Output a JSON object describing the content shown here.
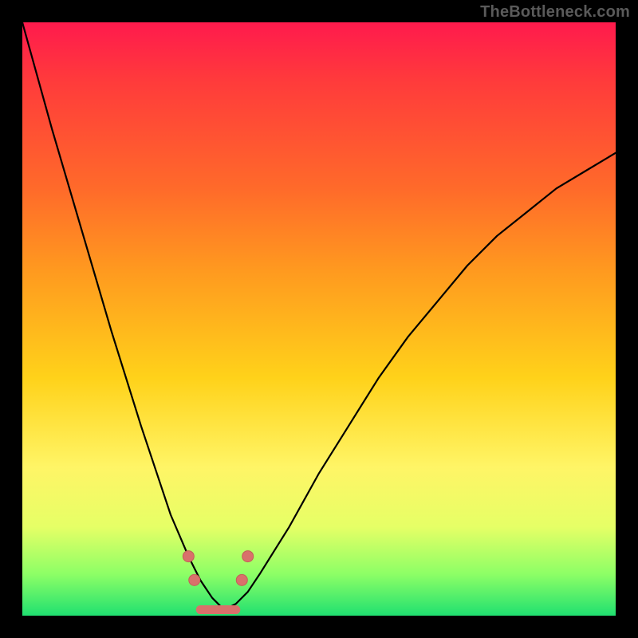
{
  "watermark": "TheBottleneck.com",
  "chart_data": {
    "type": "line",
    "title": "",
    "xlabel": "",
    "ylabel": "",
    "xlim": [
      0,
      100
    ],
    "ylim": [
      0,
      100
    ],
    "description": "Black V-shaped bottleneck curve over a red-to-green vertical gradient. Y values represent vertical position as a percent of plot height (0 = top, 100 = bottom). Minimum (valley) sits near x≈34 at y≈100.",
    "series": [
      {
        "name": "bottleneck-curve",
        "x": [
          0,
          5,
          10,
          15,
          20,
          25,
          28,
          30,
          32,
          34,
          36,
          38,
          40,
          45,
          50,
          55,
          60,
          65,
          70,
          75,
          80,
          85,
          90,
          95,
          100
        ],
        "y": [
          0,
          18,
          35,
          52,
          68,
          83,
          90,
          94,
          97,
          99,
          98,
          96,
          93,
          85,
          76,
          68,
          60,
          53,
          47,
          41,
          36,
          32,
          28,
          25,
          22
        ]
      }
    ],
    "markers": {
      "name": "valley-markers",
      "color": "#d9716b",
      "points": [
        {
          "x": 28,
          "y": 90
        },
        {
          "x": 29,
          "y": 94
        },
        {
          "x": 37,
          "y": 94
        },
        {
          "x": 38,
          "y": 90
        }
      ],
      "valley_segment": {
        "x0": 30,
        "x1": 36,
        "y": 99
      }
    },
    "gradient_stops": [
      {
        "pos": 0,
        "color": "#ff1a4d"
      },
      {
        "pos": 60,
        "color": "#ffd21a"
      },
      {
        "pos": 100,
        "color": "#20e070"
      }
    ]
  }
}
